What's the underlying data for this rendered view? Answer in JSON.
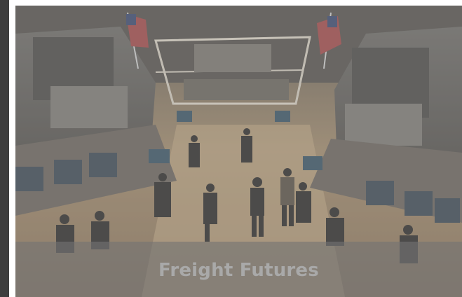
{
  "banner": {
    "title": "Freight Futures"
  },
  "colors": {
    "left_bar": "#3e3e3e",
    "caption_band": "#787878",
    "caption_text": "#a9a9a9"
  }
}
